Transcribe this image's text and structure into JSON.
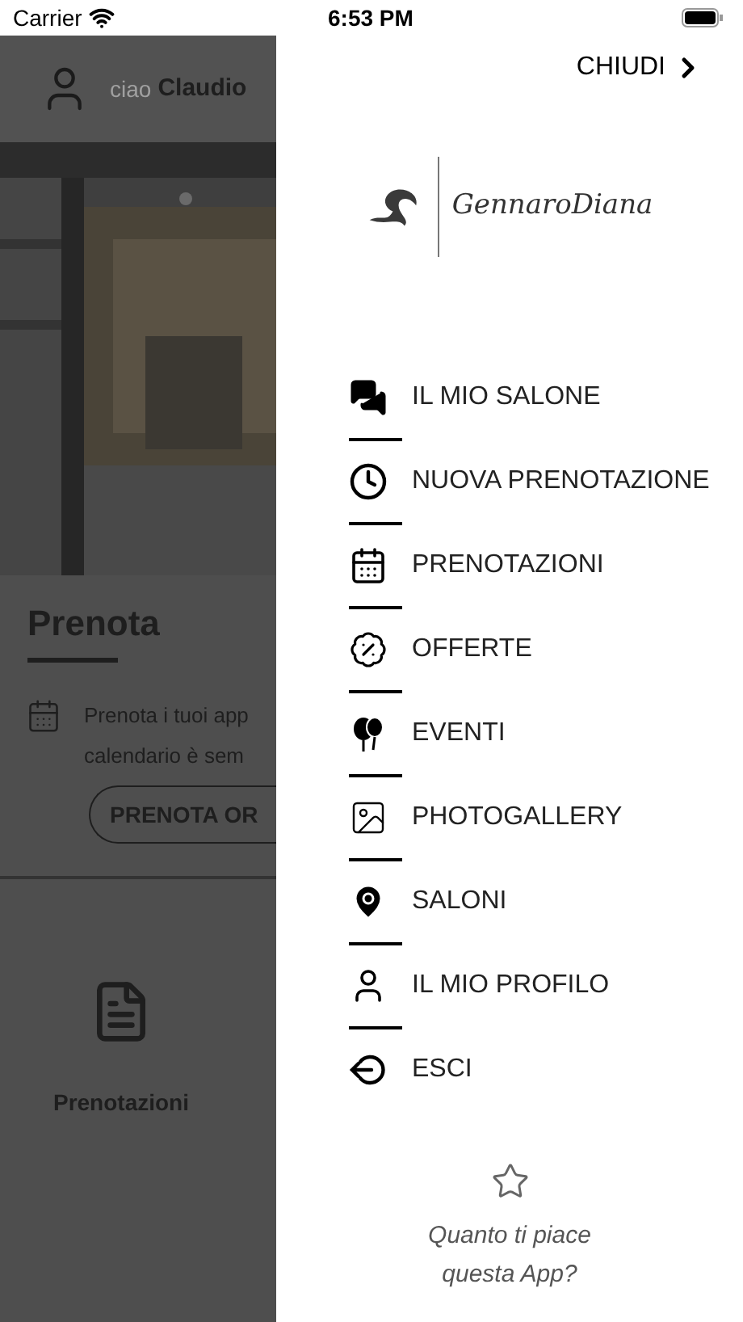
{
  "status_bar": {
    "carrier": "Carrier",
    "time": "6:53 PM"
  },
  "background": {
    "greeting": "ciao",
    "user": "Claudio",
    "section_title": "Prenota",
    "description_lines": [
      "Prenota i tuoi app",
      "calendario è sem"
    ],
    "button": "PRENOTA OR",
    "tile_label": "Prenotazioni"
  },
  "drawer": {
    "close": "CHIUDI",
    "logo_text": "GennaroDiana",
    "menu": [
      {
        "label": "IL MIO SALONE"
      },
      {
        "label": "NUOVA PRENOTAZIONE"
      },
      {
        "label": "PRENOTAZIONI"
      },
      {
        "label": "OFFERTE"
      },
      {
        "label": "EVENTI"
      },
      {
        "label": "PHOTOGALLERY"
      },
      {
        "label": "SALONI"
      },
      {
        "label": "IL MIO PROFILO"
      },
      {
        "label": "ESCI"
      }
    ],
    "rating_prompt_lines": [
      "Quanto ti piace",
      "questa App?"
    ]
  }
}
